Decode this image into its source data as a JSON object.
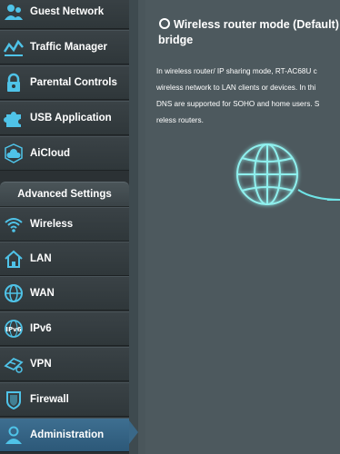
{
  "sidebar": {
    "general_items": [
      {
        "label": "Guest Network",
        "icon": "guest-network-icon"
      },
      {
        "label": "Traffic Manager",
        "icon": "traffic-manager-icon"
      },
      {
        "label": "Parental Controls",
        "icon": "parental-controls-icon"
      },
      {
        "label": "USB Application",
        "icon": "usb-application-icon"
      },
      {
        "label": "AiCloud",
        "icon": "aicloud-icon"
      }
    ],
    "section_header": "Advanced Settings",
    "advanced_items": [
      {
        "label": "Wireless",
        "icon": "wireless-icon"
      },
      {
        "label": "LAN",
        "icon": "lan-icon"
      },
      {
        "label": "WAN",
        "icon": "wan-icon"
      },
      {
        "label": "IPv6",
        "icon": "ipv6-icon"
      },
      {
        "label": "VPN",
        "icon": "vpn-icon"
      },
      {
        "label": "Firewall",
        "icon": "firewall-icon"
      },
      {
        "label": "Administration",
        "icon": "administration-icon",
        "active": true
      }
    ]
  },
  "main": {
    "mode_title_line1": "Wireless router mode (Default)",
    "mode_title_line2": "bridge",
    "description_lines": [
      "In wireless router/ IP sharing mode, RT-AC68U c",
      "wireless network to LAN clients or devices. In thi",
      "DNS are supported for SOHO and home users. S",
      "reless routers."
    ]
  },
  "colors": {
    "icon_cyan": "#4fc3e8",
    "active_bg": "#3a6888",
    "globe_glow": "#7fe9e9"
  }
}
